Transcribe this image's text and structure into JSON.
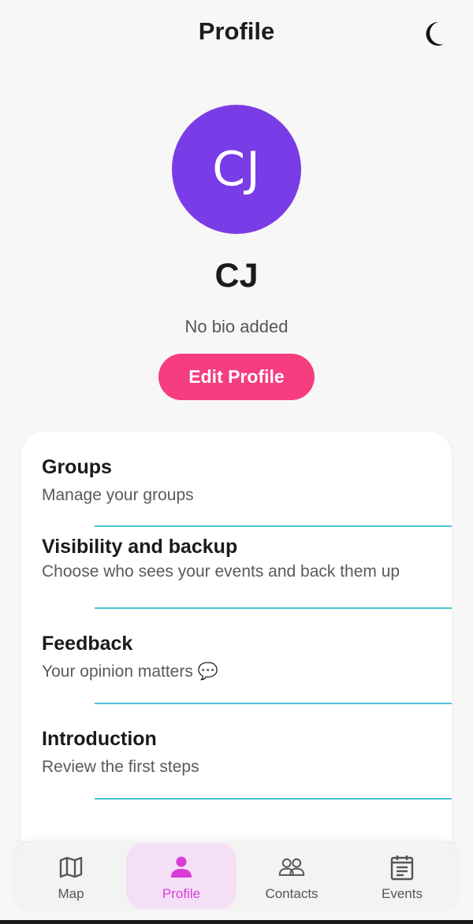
{
  "header": {
    "title": "Profile",
    "theme_toggle_icon": "moon-icon"
  },
  "profile": {
    "avatar_initials": "CJ",
    "avatar_color": "#7a3ce6",
    "name": "CJ",
    "bio": "No bio added",
    "edit_button_label": "Edit Profile",
    "edit_button_color": "#f53d7f"
  },
  "menu": {
    "items": [
      {
        "title": "Groups",
        "subtitle": "Manage your groups"
      },
      {
        "title": "Visibility and backup",
        "subtitle": "Choose who sees your events and back them up"
      },
      {
        "title": "Feedback",
        "subtitle": "Your opinion matters 💬"
      },
      {
        "title": "Introduction",
        "subtitle": "Review the first steps"
      }
    ],
    "divider_color": "#4cc3d6"
  },
  "bottom_nav": {
    "items": [
      {
        "label": "Map",
        "icon": "map-icon"
      },
      {
        "label": "Profile",
        "icon": "person-icon",
        "active": true
      },
      {
        "label": "Contacts",
        "icon": "contacts-icon"
      },
      {
        "label": "Events",
        "icon": "calendar-icon"
      }
    ],
    "active_color": "#d93cd6",
    "active_bg": "#f5dff7"
  }
}
